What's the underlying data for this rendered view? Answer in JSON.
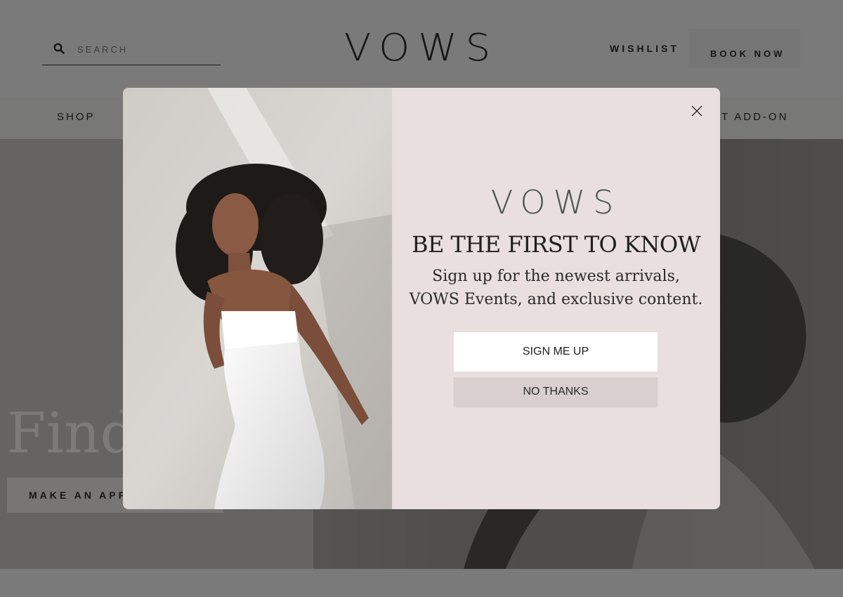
{
  "header": {
    "search_placeholder": "SEARCH",
    "logo": "VOWS",
    "wishlist": "WISHLIST",
    "book_now": "BOOK NOW"
  },
  "nav": {
    "items": [
      {
        "label": "SHOP"
      },
      {
        "label": "T ADD-ON"
      }
    ]
  },
  "hero": {
    "title": "Find",
    "button": "MAKE AN APPO"
  },
  "modal": {
    "logo": "VOWS",
    "heading": "BE THE FIRST TO KNOW",
    "subtitle_line1": "Sign up for the newest arrivals,",
    "subtitle_line2": "VOWS Events, and exclusive content.",
    "signup_label": "SIGN ME UP",
    "nothanks_label": "NO THANKS"
  },
  "colors": {
    "modal_bg": "#e8dfde",
    "logo_green": "#4b5650",
    "text_dark": "#1f1f1f"
  },
  "icons": {
    "search": "search-icon",
    "close": "close-icon"
  }
}
